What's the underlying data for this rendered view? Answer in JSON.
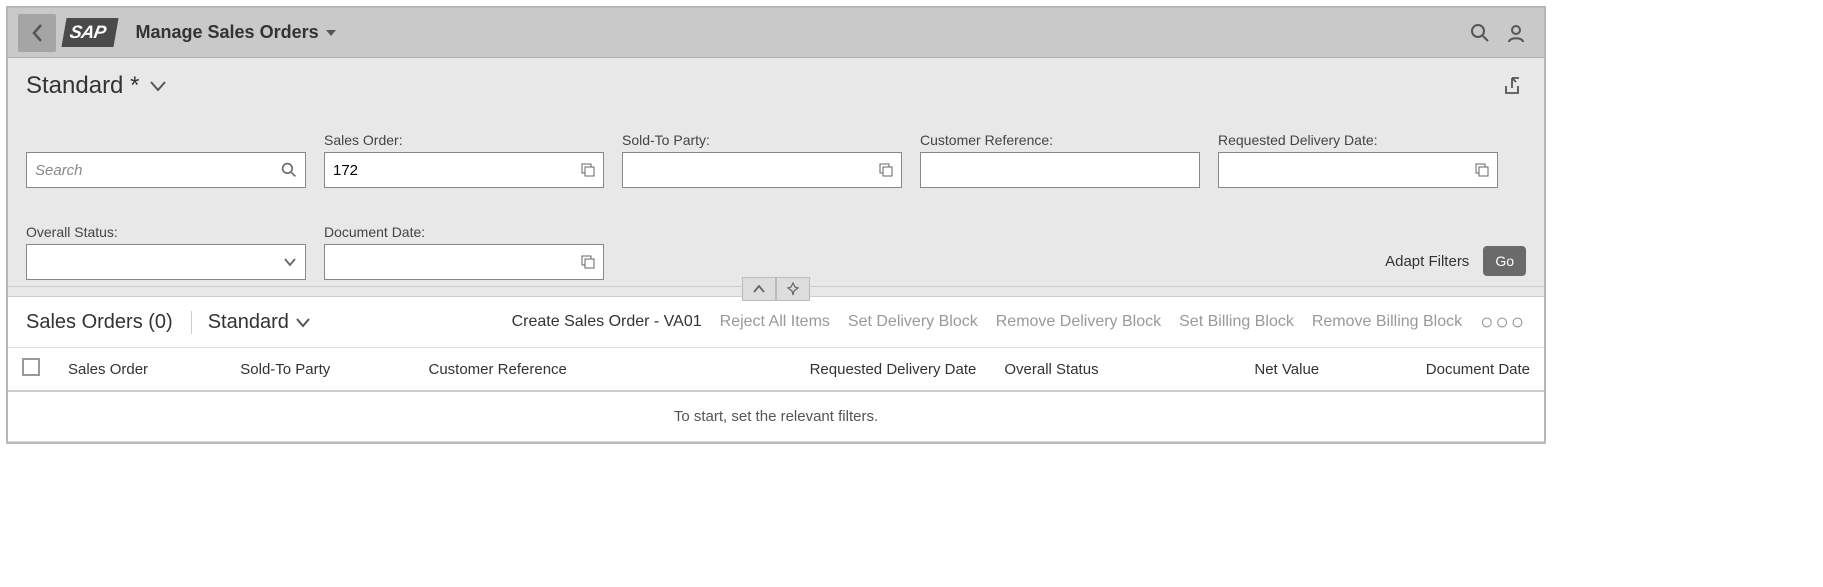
{
  "header": {
    "logo_text": "SAP",
    "app_title": "Manage Sales Orders"
  },
  "variant": {
    "name": "Standard *"
  },
  "filters": {
    "search_placeholder": "Search",
    "sales_order": {
      "label": "Sales Order:",
      "value": "172"
    },
    "sold_to": {
      "label": "Sold-To Party:",
      "value": ""
    },
    "customer_ref": {
      "label": "Customer Reference:",
      "value": ""
    },
    "req_delivery": {
      "label": "Requested Delivery Date:",
      "value": ""
    },
    "overall_status": {
      "label": "Overall Status:",
      "value": ""
    },
    "doc_date": {
      "label": "Document Date:",
      "value": ""
    },
    "adapt_label": "Adapt Filters",
    "go_label": "Go"
  },
  "table": {
    "title": "Sales Orders (0)",
    "variant": "Standard",
    "actions": {
      "create": "Create Sales Order - VA01",
      "reject": "Reject All Items",
      "set_delivery": "Set Delivery Block",
      "remove_delivery": "Remove Delivery Block",
      "set_billing": "Set Billing Block",
      "remove_billing": "Remove Billing Block"
    },
    "columns": {
      "sales_order": "Sales Order",
      "sold_to": "Sold-To Party",
      "customer_ref": "Customer Reference",
      "req_delivery": "Requested Delivery Date",
      "overall_status": "Overall Status",
      "net_value": "Net Value",
      "doc_date": "Document Date"
    },
    "empty_text": "To start, set the relevant filters."
  }
}
